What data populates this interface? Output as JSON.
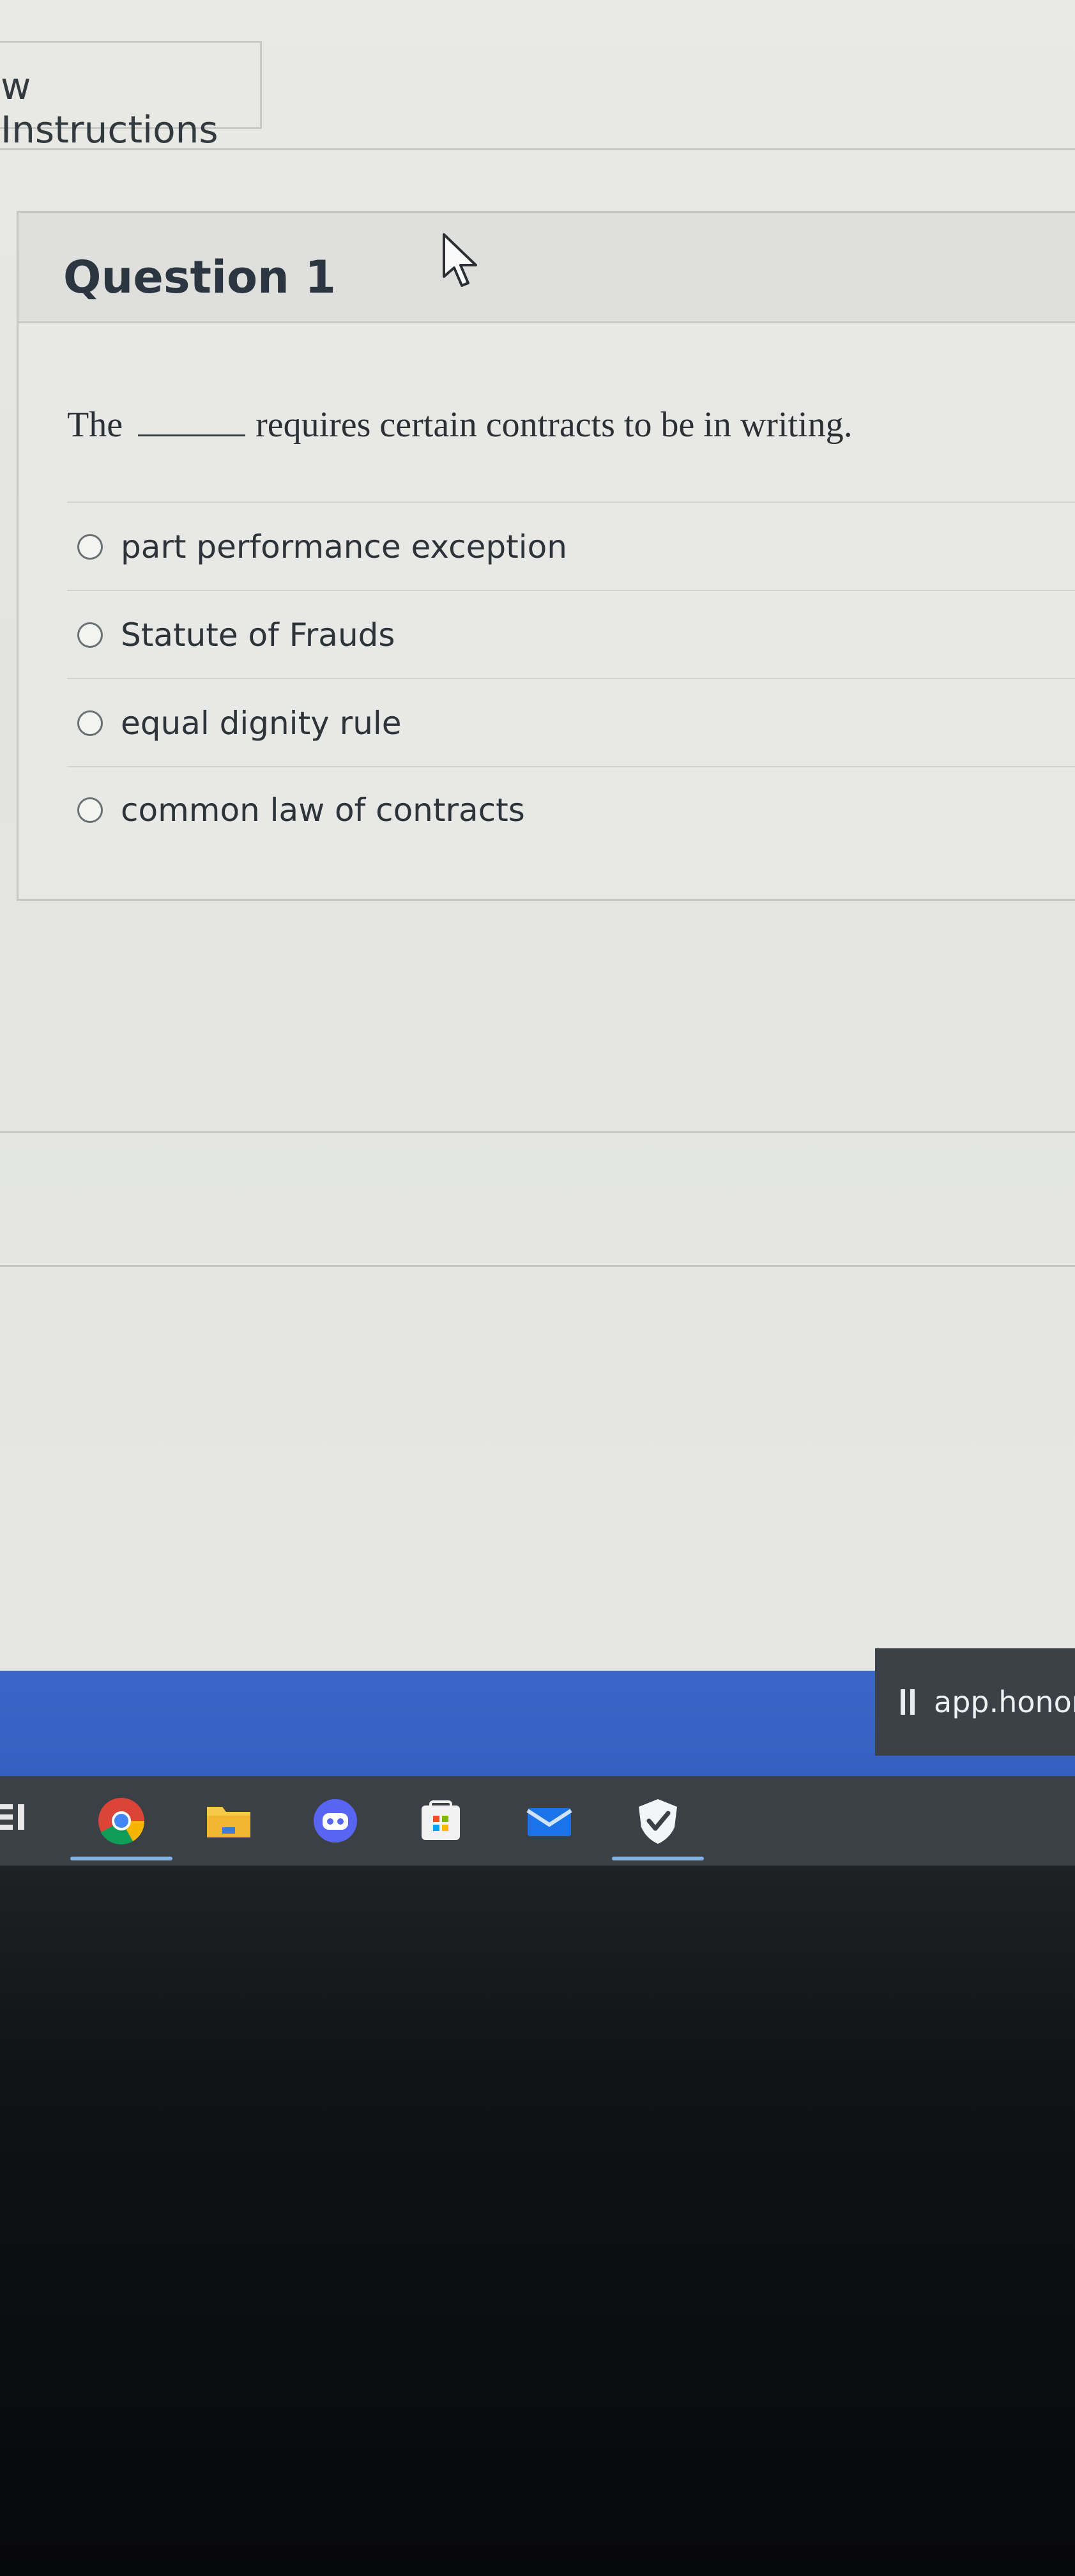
{
  "tab": {
    "label": "w Instructions"
  },
  "question": {
    "title": "Question 1",
    "text_before": "The",
    "text_after": "requires certain contracts to be in writing.",
    "answers": [
      {
        "label": "part performance exception"
      },
      {
        "label": "Statute of Frauds"
      },
      {
        "label": "equal dignity rule"
      },
      {
        "label": "common law of contracts"
      }
    ]
  },
  "taskbar": {
    "app_tab_text": "app.honorlo",
    "icons": [
      "task-view-icon",
      "chrome-icon",
      "file-explorer-icon",
      "discord-icon",
      "microsoft-store-icon",
      "mail-icon",
      "shield-check-icon"
    ]
  },
  "colors": {
    "taskbar_blue": "#3460c2",
    "taskbar_dark": "#3a4046",
    "active_underline": "#7fb3e6"
  }
}
